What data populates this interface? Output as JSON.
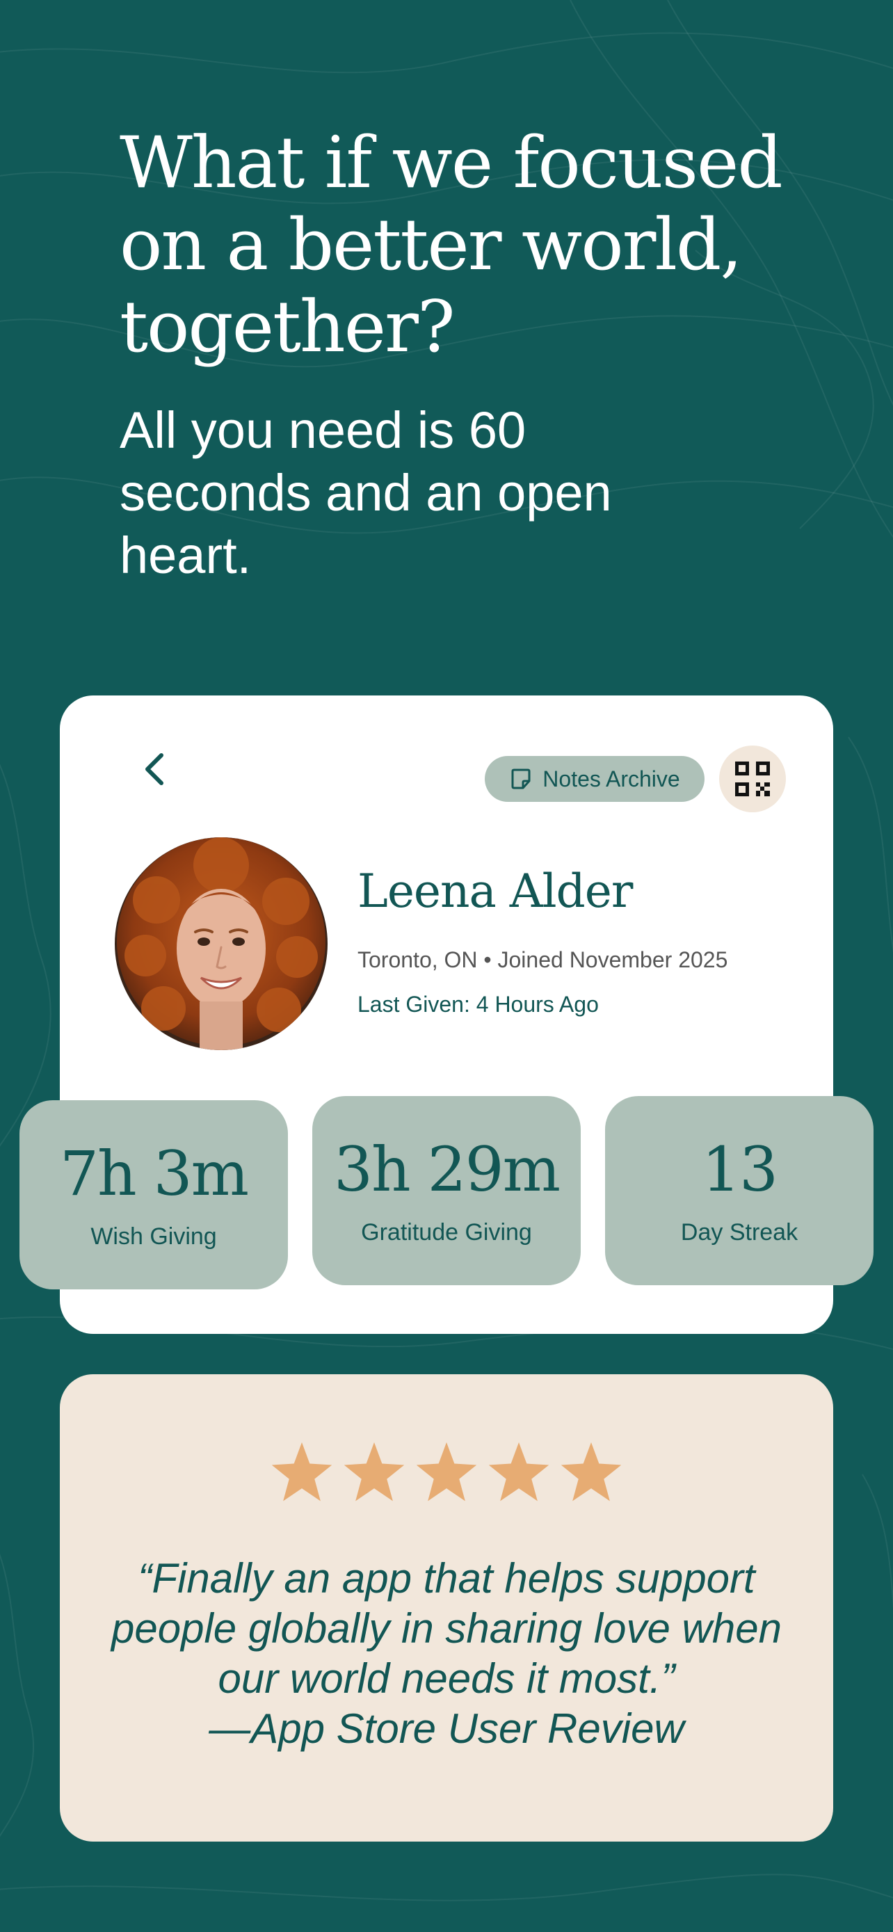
{
  "colors": {
    "background": "#115A58",
    "card": "#FFFFFF",
    "tile": "#AEC1B8",
    "accent_text": "#125654",
    "review_card": "#F2E7DB",
    "star": "#E7AC73"
  },
  "hero": {
    "headline": "What if we focused on a better world, together?",
    "subhead": "All you need is 60 seconds and an open heart."
  },
  "profile": {
    "back_icon": "chevron-left-icon",
    "notes_archive": {
      "icon": "note-icon",
      "label": "Notes Archive"
    },
    "qr_icon": "qr-code-icon",
    "name": "Leena Alder",
    "meta": "Toronto, ON • Joined November 2025",
    "last_given": "Last Given: 4 Hours Ago",
    "stats": [
      {
        "value": "7h 3m",
        "label": "Wish Giving"
      },
      {
        "value": "3h 29m",
        "label": "Gratitude Giving"
      },
      {
        "value": "13",
        "label": "Day Streak"
      }
    ]
  },
  "review": {
    "rating": 5,
    "max_rating": 5,
    "quote": "“Finally an app that helps support people globally in sharing love when our world needs it most.”",
    "attribution": "—App Store User Review"
  }
}
